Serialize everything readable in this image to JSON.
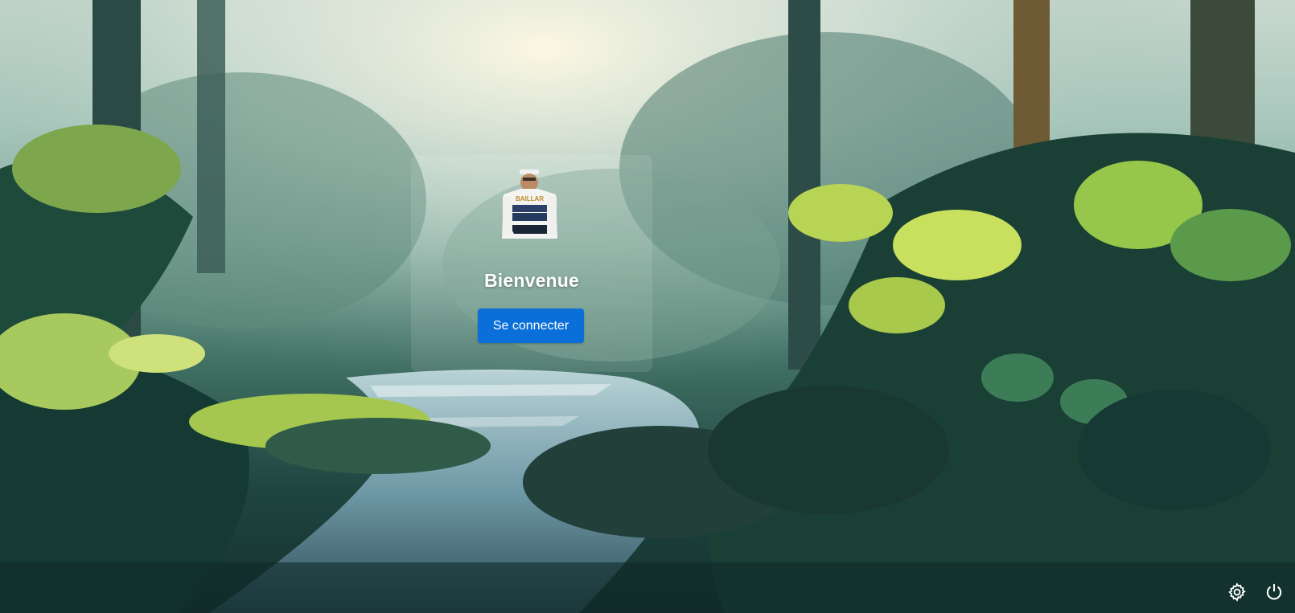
{
  "screen": {
    "title": "Bienvenue",
    "signin_button_label": "Se connecter"
  },
  "icons": {
    "settings": "gear-icon",
    "power": "power-icon"
  },
  "colors": {
    "accent": "#0a6fd8",
    "text_on_overlay": "#ffffff"
  }
}
